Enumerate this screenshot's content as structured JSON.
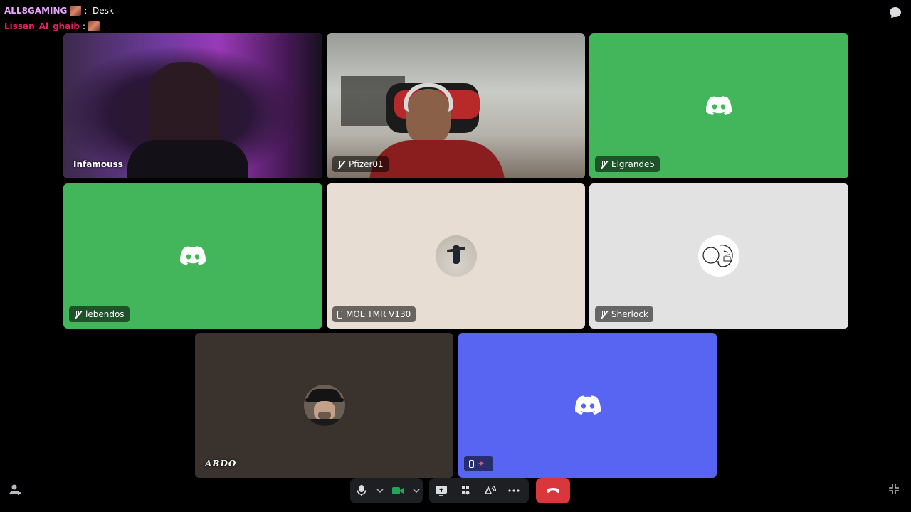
{
  "overlay_chat": [
    {
      "name": "ALL8GAMING",
      "name_color": "#e8a6ff",
      "message": ":  Desk"
    },
    {
      "name": "Lissan_Al_ghaib",
      "name_color": "#e0245e",
      "message": ":"
    }
  ],
  "tiles": [
    {
      "name": "Infamouss",
      "status": "speaking",
      "type": "camera"
    },
    {
      "name": "Pfizer01",
      "status": "muted",
      "type": "camera"
    },
    {
      "name": "Elgrande5",
      "status": "muted",
      "type": "default-avatar",
      "bg": "#43b55a"
    },
    {
      "name": "lebendos",
      "status": "muted",
      "type": "default-avatar",
      "bg": "#43b55a"
    },
    {
      "name": "MOL TMR V130",
      "status": "mobile",
      "type": "avatar",
      "bg": "#e7ddd2"
    },
    {
      "name": "Sherlock",
      "status": "muted",
      "type": "avatar",
      "bg": "#e2e2e2"
    },
    {
      "name": "ABDO",
      "status": "none",
      "type": "avatar",
      "bg": "#3a322c"
    },
    {
      "name": "",
      "status": "mobile",
      "type": "default-avatar",
      "bg": "#5865f2"
    }
  ],
  "controls": {
    "mic_icon": "microphone-icon",
    "camera_icon": "video-camera-icon",
    "share_icon": "screen-share-icon",
    "activities_icon": "activities-icon",
    "soundboard_icon": "soundboard-icon",
    "more_icon": "more-options-icon",
    "hangup_icon": "hang-up-icon",
    "hangup_color": "#da373c"
  }
}
